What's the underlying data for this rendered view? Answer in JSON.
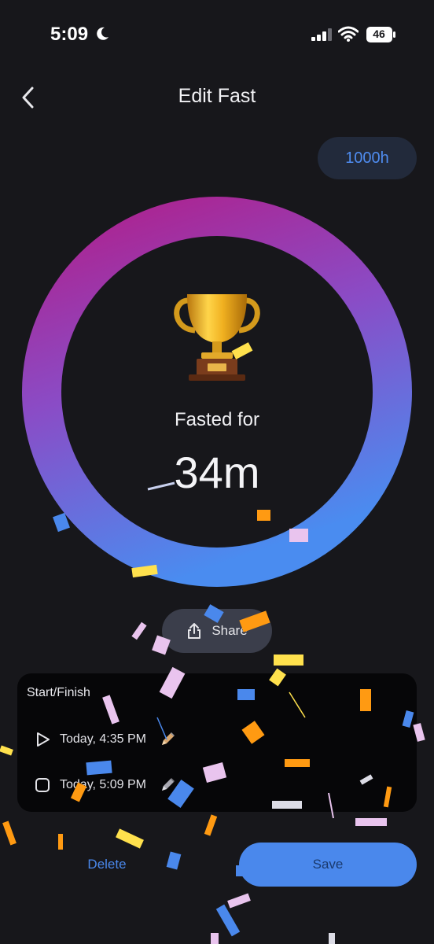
{
  "status_bar": {
    "time": "5:09",
    "battery": "46",
    "icons": [
      "moon-icon",
      "signal-icon",
      "wifi-icon",
      "battery-icon"
    ]
  },
  "header": {
    "title": "Edit Fast",
    "back_icon": "chevron-left-icon"
  },
  "goal": {
    "label": "1000h"
  },
  "progress": {
    "label": "Fasted for",
    "value": "34m",
    "icon": "trophy-icon",
    "colors": {
      "top": "#b41a84",
      "middle": "#8a4cc6",
      "bottom": "#4a8cf0",
      "track_bg": "#17171b"
    }
  },
  "share": {
    "label": "Share",
    "icon": "share-icon"
  },
  "times": {
    "title": "Start/Finish",
    "start": {
      "text": "Today, 4:35 PM",
      "icon": "play-icon",
      "edit_icon": "pencil-icon"
    },
    "end": {
      "text": "Today, 5:09 PM",
      "icon": "stop-icon",
      "edit_icon": "pencil-icon"
    }
  },
  "actions": {
    "delete_label": "Delete",
    "save_label": "Save",
    "accent": "#4a88ec"
  }
}
